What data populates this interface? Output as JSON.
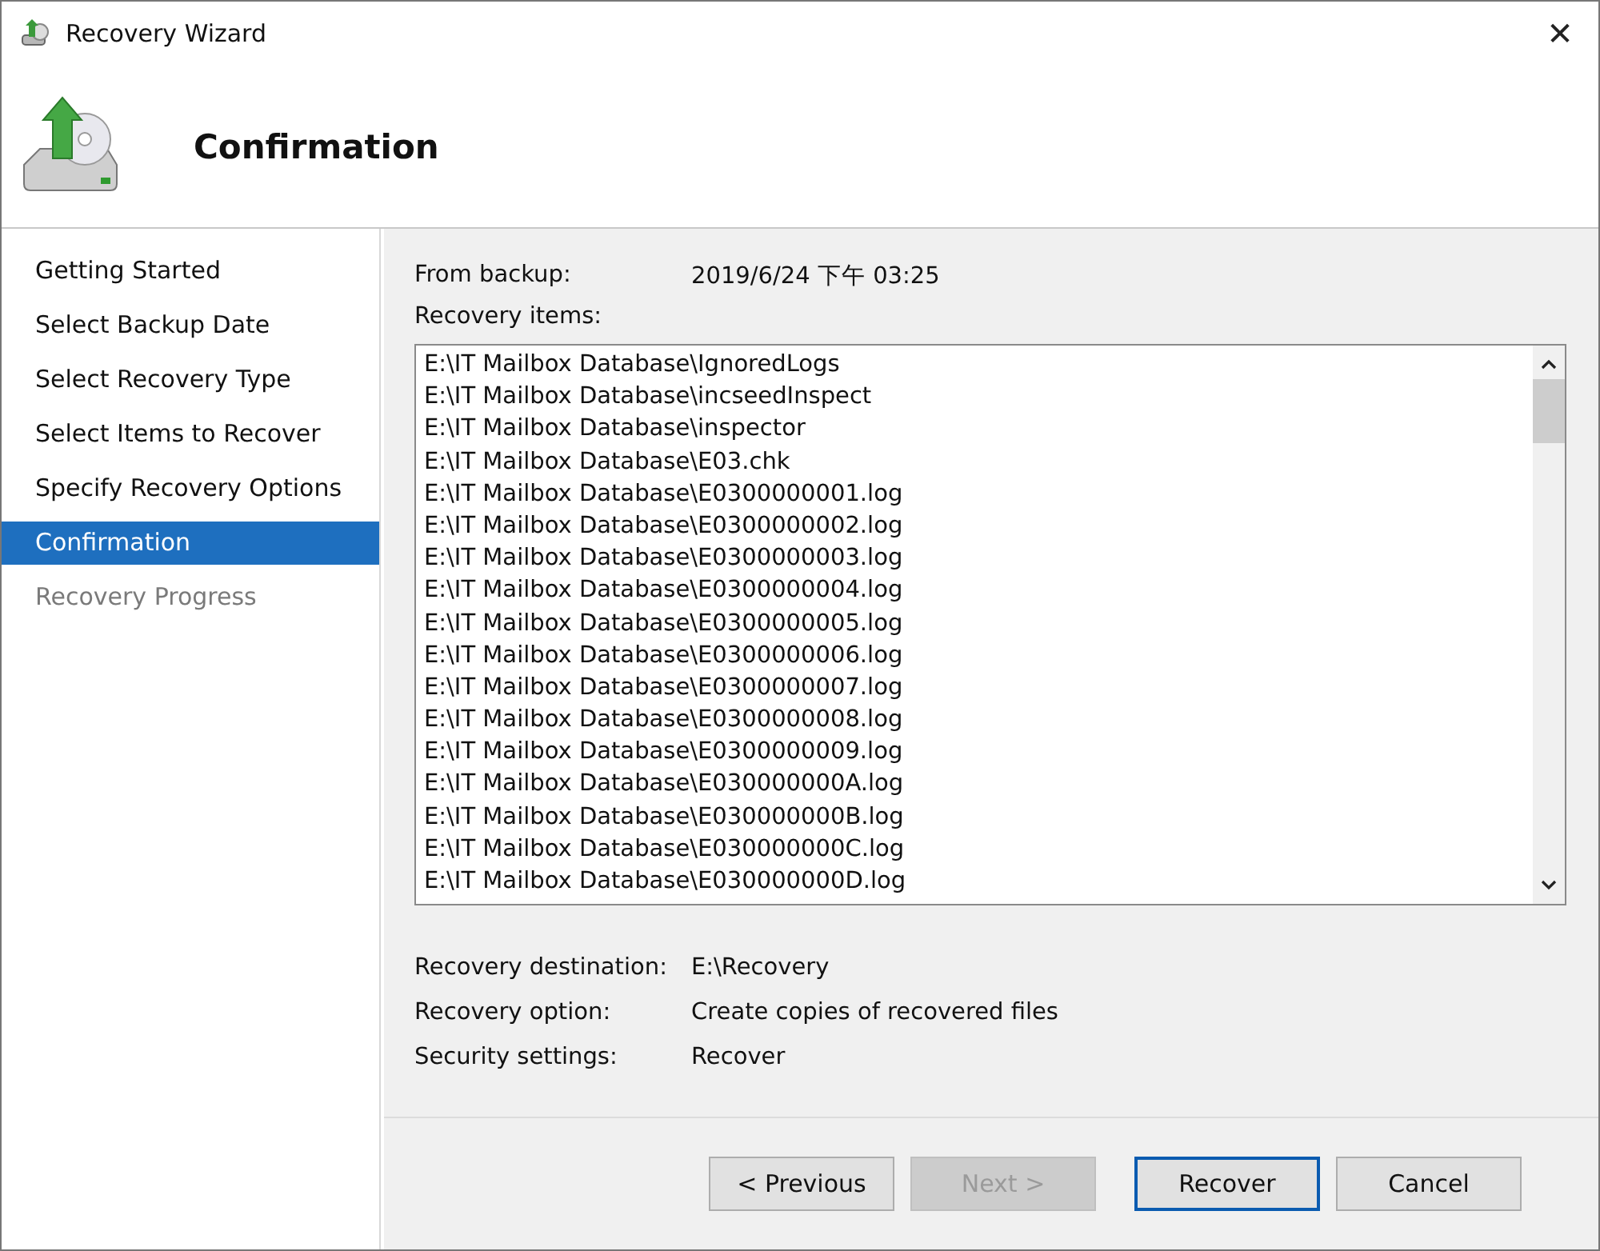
{
  "window": {
    "title": "Recovery Wizard",
    "close_label": "✕"
  },
  "header": {
    "title": "Confirmation"
  },
  "steps": [
    {
      "label": "Getting Started",
      "selected": false,
      "disabled": false
    },
    {
      "label": "Select Backup Date",
      "selected": false,
      "disabled": false
    },
    {
      "label": "Select Recovery Type",
      "selected": false,
      "disabled": false
    },
    {
      "label": "Select Items to Recover",
      "selected": false,
      "disabled": false
    },
    {
      "label": "Specify Recovery Options",
      "selected": false,
      "disabled": false
    },
    {
      "label": "Confirmation",
      "selected": true,
      "disabled": false
    },
    {
      "label": "Recovery Progress",
      "selected": false,
      "disabled": true
    }
  ],
  "from_backup": {
    "label": "From backup:",
    "value": "2019/6/24 下午 03:25"
  },
  "recovery_items": {
    "label": "Recovery items:",
    "items": [
      "E:\\IT Mailbox Database\\IgnoredLogs",
      "E:\\IT Mailbox Database\\incseedInspect",
      "E:\\IT Mailbox Database\\inspector",
      "E:\\IT Mailbox Database\\E03.chk",
      "E:\\IT Mailbox Database\\E0300000001.log",
      "E:\\IT Mailbox Database\\E0300000002.log",
      "E:\\IT Mailbox Database\\E0300000003.log",
      "E:\\IT Mailbox Database\\E0300000004.log",
      "E:\\IT Mailbox Database\\E0300000005.log",
      "E:\\IT Mailbox Database\\E0300000006.log",
      "E:\\IT Mailbox Database\\E0300000007.log",
      "E:\\IT Mailbox Database\\E0300000008.log",
      "E:\\IT Mailbox Database\\E0300000009.log",
      "E:\\IT Mailbox Database\\E030000000A.log",
      "E:\\IT Mailbox Database\\E030000000B.log",
      "E:\\IT Mailbox Database\\E030000000C.log",
      "E:\\IT Mailbox Database\\E030000000D.log"
    ]
  },
  "summary": [
    {
      "label": "Recovery destination:",
      "value": "E:\\Recovery"
    },
    {
      "label": "Recovery option:",
      "value": "Create copies of recovered files"
    },
    {
      "label": "Security settings:",
      "value": "Recover"
    }
  ],
  "buttons": [
    {
      "label": "< Previous",
      "disabled": false,
      "default": false
    },
    {
      "label": "Next >",
      "disabled": true,
      "default": false
    },
    {
      "label": "Recover",
      "disabled": false,
      "default": true
    },
    {
      "label": "Cancel",
      "disabled": false,
      "default": false
    }
  ]
}
